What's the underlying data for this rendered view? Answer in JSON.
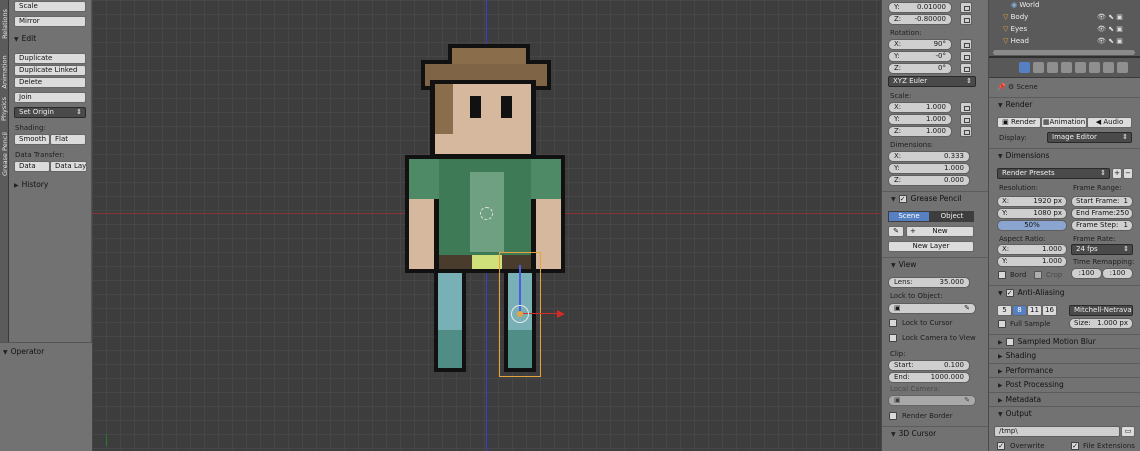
{
  "vertical_tabs": [
    "Relations",
    "Animation",
    "Physics",
    "Grease Pencil"
  ],
  "toolshelf": {
    "scale": "Scale",
    "mirror": "Mirror",
    "edit_header": "Edit",
    "duplicate": "Duplicate",
    "duplicate_linked": "Duplicate Linked",
    "delete": "Delete",
    "join": "Join",
    "set_origin": "Set Origin",
    "shading_label": "Shading:",
    "smooth": "Smooth",
    "flat": "Flat",
    "data_transfer_label": "Data Transfer:",
    "data": "Data",
    "data_layout": "Data Layo",
    "history": "History"
  },
  "operator_panel": {
    "title": "Operator"
  },
  "viewport": {
    "axis_colors": {
      "x": "#8a3434",
      "y": "#3b3bd0"
    },
    "selection_color": "#e8a33c"
  },
  "npanel": {
    "location_y_label": "Y:",
    "location_y": "0.01000",
    "location_z_label": "Z:",
    "location_z": "-0.80000",
    "rotation_label": "Rotation:",
    "rot_x_label": "X:",
    "rot_x": "90°",
    "rot_y_label": "Y:",
    "rot_y": "-0°",
    "rot_z_label": "Z:",
    "rot_z": "0°",
    "rotation_mode": "XYZ Euler",
    "scale_label": "Scale:",
    "scale_x_label": "X:",
    "scale_x": "1.000",
    "scale_y_label": "Y:",
    "scale_y": "1.000",
    "scale_z_label": "Z:",
    "scale_z": "1.000",
    "dimensions_label": "Dimensions:",
    "dim_x_label": "X:",
    "dim_x": "0.333",
    "dim_y_label": "Y:",
    "dim_y": "1.000",
    "dim_z_label": "Z:",
    "dim_z": "0.000",
    "grease_pencil": "Grease Pencil",
    "scene_btn": "Scene",
    "object_btn": "Object",
    "new_btn": "New",
    "new_layer": "New Layer",
    "view_header": "View",
    "lens_label": "Lens:",
    "lens": "35.000",
    "lock_to_object": "Lock to Object:",
    "lock_to_cursor": "Lock to Cursor",
    "lock_camera": "Lock Camera to View",
    "clip_label": "Clip:",
    "clip_start_label": "Start:",
    "clip_start": "0.100",
    "clip_end_label": "End:",
    "clip_end": "1000.000",
    "local_camera": "Local Camera:",
    "render_border": "Render Border",
    "cursor_3d": "3D Cursor"
  },
  "outliner": {
    "items": [
      {
        "label": "World"
      },
      {
        "label": "Body"
      },
      {
        "label": "Eyes"
      },
      {
        "label": "Head"
      }
    ]
  },
  "properties": {
    "scene_label": "Scene",
    "render_header": "Render",
    "render_btn": "Render",
    "animation_btn": "Animation",
    "audio_btn": "Audio",
    "display_label": "Display:",
    "display_value": "Image Editor",
    "dimensions_header": "Dimensions",
    "render_presets": "Render Presets",
    "resolution_label": "Resolution:",
    "res_x_label": "X:",
    "res_x": "1920 px",
    "res_y_label": "Y:",
    "res_y": "1080 px",
    "res_pct": "50%",
    "frame_range_label": "Frame Range:",
    "start_frame_label": "Start Frame:",
    "start_frame": "1",
    "end_frame_label": "End Frame:",
    "end_frame": "250",
    "frame_step_label": "Frame Step:",
    "frame_step": "1",
    "aspect_label": "Aspect Ratio:",
    "aspect_x_label": "X:",
    "aspect_x": "1.000",
    "aspect_y_label": "Y:",
    "aspect_y": "1.000",
    "frame_rate_label": "Frame Rate:",
    "frame_rate": "24 fps",
    "bord": "Bord",
    "crop": "Crop",
    "time_remap_label": "Time Remapping:",
    "remap_old": ":100",
    "remap_new": ":100",
    "aa_header": "Anti-Aliasing",
    "aa_samples": [
      "5",
      "8",
      "11",
      "16"
    ],
    "aa_selected": "8",
    "aa_filter": "Mitchell-Netravali",
    "full_sample": "Full Sample",
    "size_label": "Size:",
    "size": "1.000 px",
    "motion_blur": "Sampled Motion Blur",
    "shading": "Shading",
    "performance": "Performance",
    "post_processing": "Post Processing",
    "metadata": "Metadata",
    "output_header": "Output",
    "output_path": "/tmp\\",
    "overwrite": "Overwrite",
    "file_extensions": "File Extensions"
  }
}
